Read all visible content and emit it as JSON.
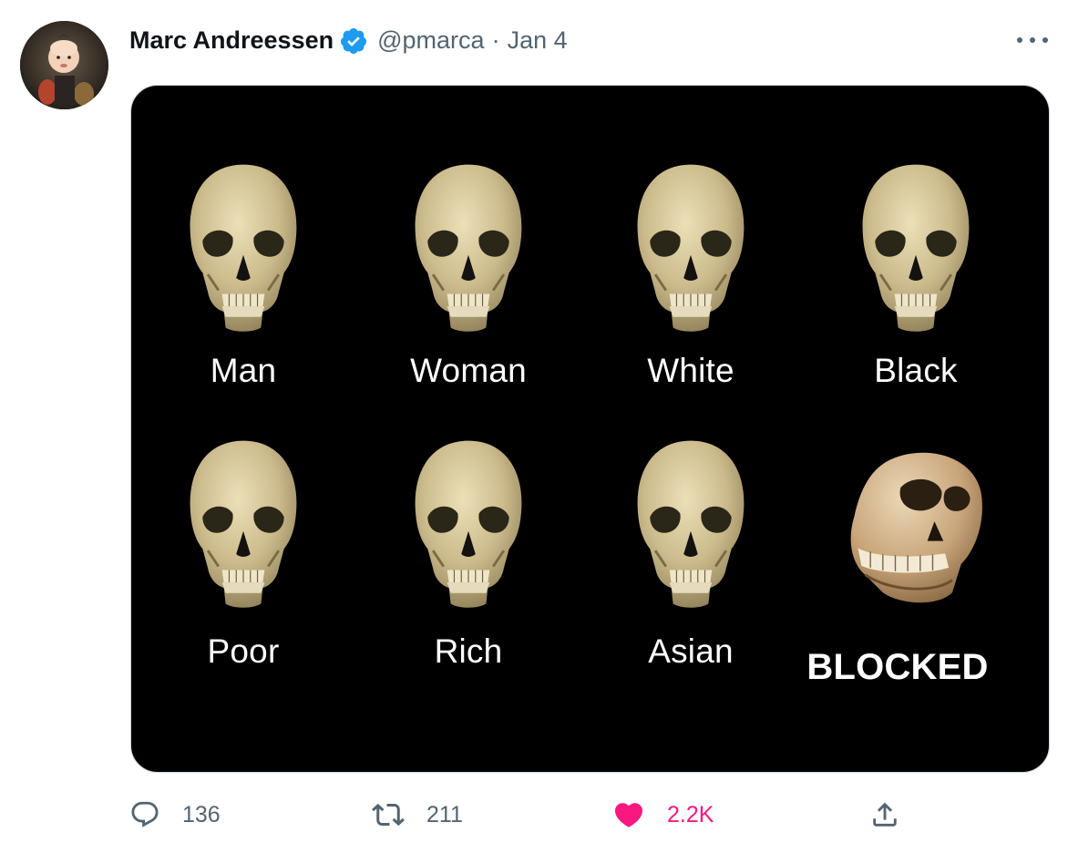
{
  "tweet": {
    "author": {
      "display_name": "Marc Andreessen",
      "handle": "@pmarca",
      "verified": true,
      "avatar_icon": "avatar-photo"
    },
    "separator": "·",
    "date": "Jan 4",
    "more_icon": "more-horizontal-icon"
  },
  "media": {
    "background": "#000000",
    "captions": [
      "Man",
      "Woman",
      "White",
      "Black",
      "Poor",
      "Rich",
      "Asian",
      "BLOCKED"
    ]
  },
  "actions": {
    "reply": {
      "icon": "reply-icon",
      "count": "136"
    },
    "retweet": {
      "icon": "retweet-icon",
      "count": "211"
    },
    "like": {
      "icon": "heart-icon",
      "count": "2.2K",
      "liked": true,
      "color": "#f91880"
    },
    "share": {
      "icon": "share-icon"
    }
  },
  "colors": {
    "text_primary": "#0f1419",
    "text_secondary": "#536471",
    "verified_blue": "#1d9bf0",
    "like_pink": "#f91880",
    "border": "#cfd9de"
  }
}
